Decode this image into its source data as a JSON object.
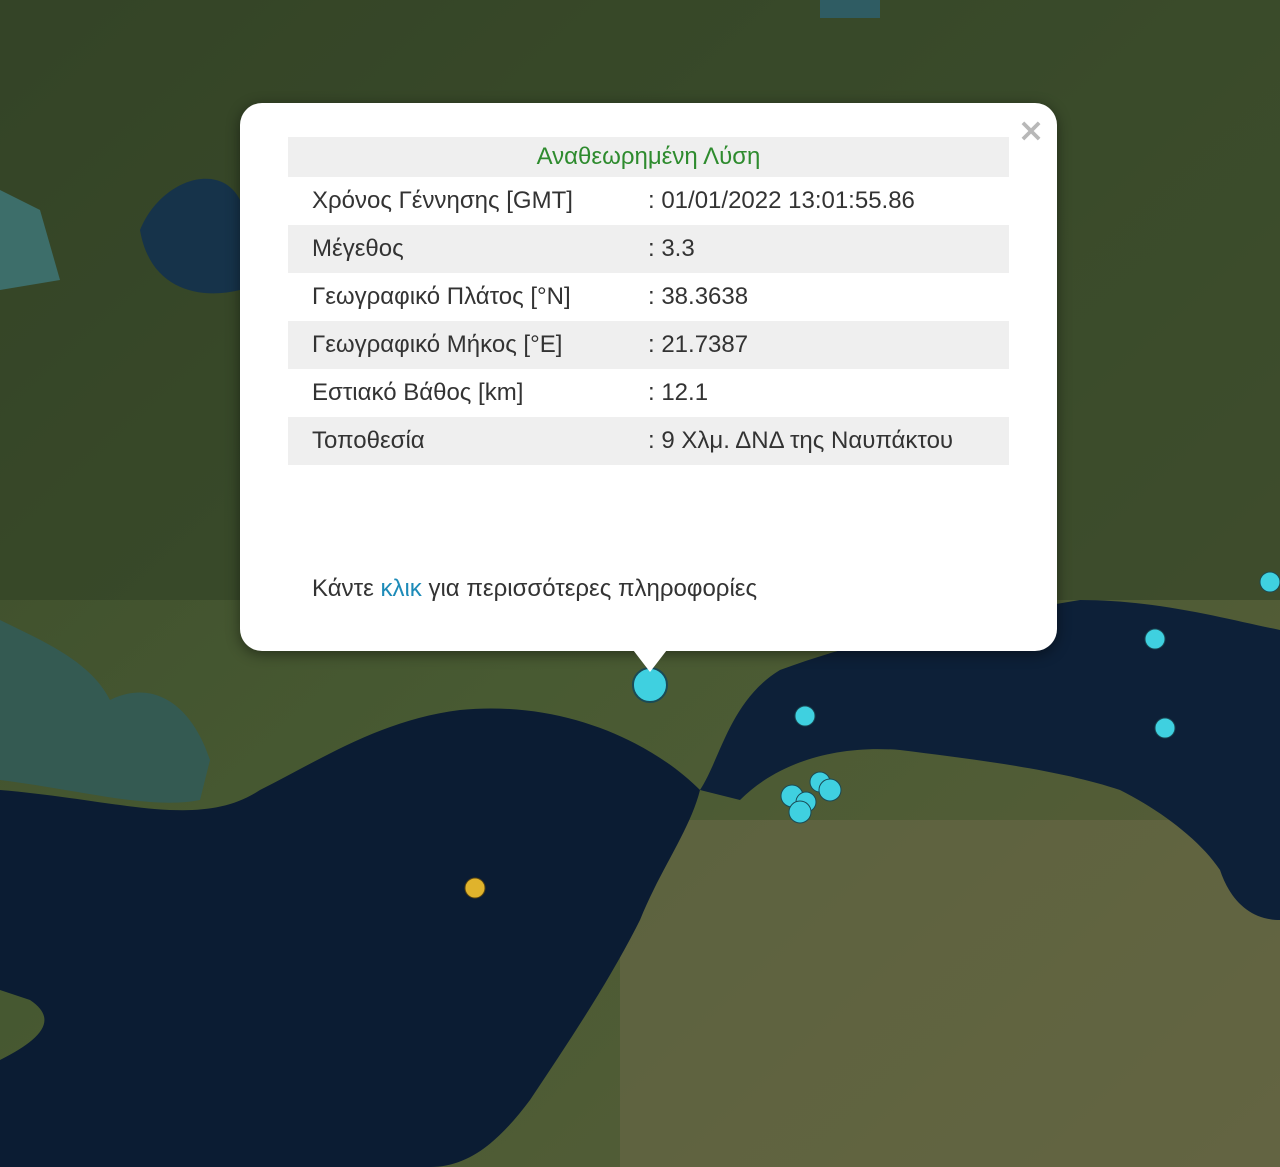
{
  "popup": {
    "title": "Αναθεωρημένη Λύση",
    "close_symbol": "×",
    "rows": [
      {
        "label": "Χρόνος Γέννησης [GMT]",
        "value": ": 01/01/2022 13:01:55.86"
      },
      {
        "label": "Μέγεθος",
        "value": ": 3.3"
      },
      {
        "label": "Γεωγραφικό Πλάτος [°N]",
        "value": ": 38.3638"
      },
      {
        "label": "Γεωγραφικό Μήκος [°E]",
        "value": ": 21.7387"
      },
      {
        "label": "Εστιακό Βάθος [km]",
        "value": ": 12.1"
      },
      {
        "label": "Τοποθεσία",
        "value": ": 9 Χλμ. ΔΝΔ της Ναυπάκτου"
      }
    ],
    "more_prefix": "Κάντε",
    "more_link": "κλικ",
    "more_suffix": "για περισσότερες πληροφορίες"
  },
  "colors": {
    "marker_recent": "#3fd0e0",
    "marker_yellow": "#e0b32c",
    "title_green": "#2e8b2e",
    "link_blue": "#1d8bb8"
  }
}
